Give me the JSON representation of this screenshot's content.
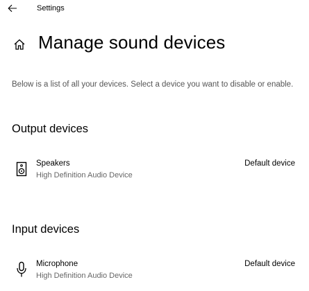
{
  "app": {
    "title": "Settings",
    "back_icon": "back-arrow-icon",
    "home_icon": "home-icon"
  },
  "page": {
    "title": "Manage sound devices",
    "description": "Below is a list of all your devices. Select a device you want to disable or enable."
  },
  "output": {
    "heading": "Output devices",
    "devices": [
      {
        "name": "Speakers",
        "description": "High Definition Audio Device",
        "status": "Default device",
        "icon": "speaker-icon"
      }
    ]
  },
  "input": {
    "heading": "Input devices",
    "devices": [
      {
        "name": "Microphone",
        "description": "High Definition Audio Device",
        "status": "Default device",
        "icon": "microphone-icon"
      }
    ]
  }
}
